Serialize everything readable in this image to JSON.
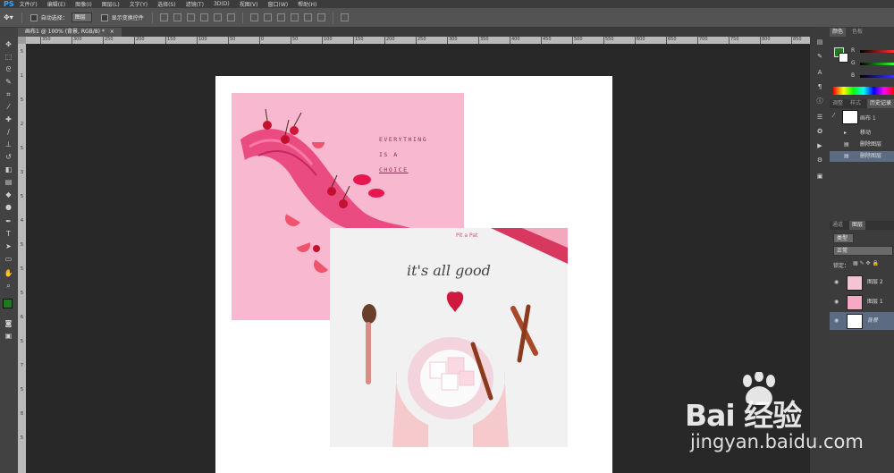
{
  "app": {
    "logo": "PS"
  },
  "menu": [
    "文件(F)",
    "编辑(E)",
    "图像(I)",
    "图层(L)",
    "文字(Y)",
    "选择(S)",
    "滤镜(T)",
    "3D(D)",
    "视图(V)",
    "窗口(W)",
    "帮助(H)"
  ],
  "options": {
    "auto_select_label": "自动选择：",
    "auto_select_value": "图层",
    "show_transform_label": "显示变换控件"
  },
  "document_tab": {
    "title": "画布1 @ 100% (背景, RGB/8) *"
  },
  "ruler_h_labels": [
    "350",
    "300",
    "250",
    "200",
    "150",
    "100",
    "50",
    "0",
    "50",
    "100",
    "150",
    "200",
    "250",
    "300",
    "350",
    "400",
    "450",
    "500",
    "550",
    "600",
    "650",
    "700",
    "750",
    "800",
    "850"
  ],
  "ruler_v_labels": [
    "5",
    "1",
    "5",
    "2",
    "5",
    "3",
    "5",
    "4",
    "5",
    "5",
    "5",
    "6",
    "5",
    "7",
    "5",
    "8",
    "5"
  ],
  "tools": [
    "move-icon",
    "marquee-icon",
    "lasso-icon",
    "quick-select-icon",
    "crop-icon",
    "eyedropper-icon",
    "healing-icon",
    "brush-icon",
    "stamp-icon",
    "history-brush-icon",
    "eraser-icon",
    "gradient-icon",
    "blur-icon",
    "dodge-icon",
    "pen-icon",
    "type-icon",
    "path-select-icon",
    "shape-icon",
    "hand-icon",
    "zoom-icon"
  ],
  "colors": {
    "foreground": "#1f7a1f",
    "background": "#ffffff",
    "canvas_bg": "#282828",
    "panel_bg": "#3c3c3c",
    "accent": "#31a8ff"
  },
  "panels": {
    "color_tabs": [
      "颜色",
      "色板"
    ],
    "slider_labels": [
      "R",
      "G",
      "B"
    ],
    "mid_tabs": [
      "调整",
      "样式",
      "历史记录"
    ],
    "history": {
      "snapshot": "画布 1",
      "items": [
        "移动",
        "删除图层",
        "删除图层"
      ]
    },
    "layers_tabs": [
      "通道",
      "图层"
    ],
    "layer_filter": "类型",
    "blend_mode": "正常",
    "lock_label": "锁定：",
    "layers": [
      "图层 2",
      "图层 1",
      "背景"
    ]
  },
  "image1": {
    "lines": [
      "EVERYTHING",
      "IS A",
      "CHOICE"
    ]
  },
  "image2": {
    "brand": "Pit a Pat",
    "script": "it's all good"
  },
  "watermark": {
    "logo_text": "Bai  经验",
    "url": "jingyan.baidu.com"
  }
}
